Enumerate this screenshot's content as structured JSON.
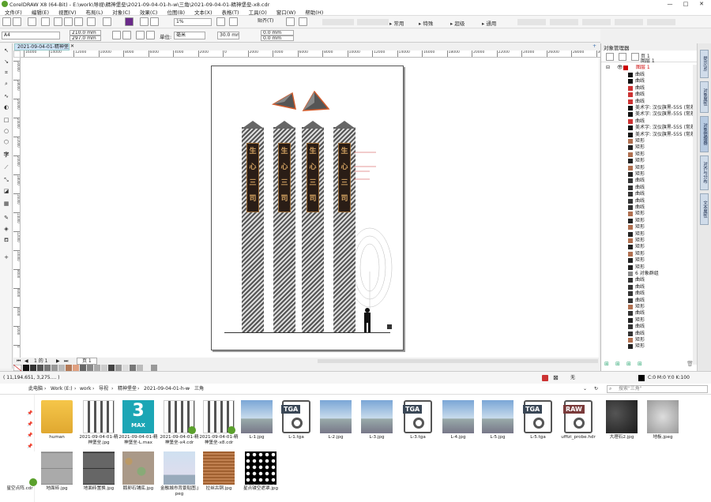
{
  "titlebar": {
    "title": "CorelDRAW X8 (64-Bit) - E:\\work\\导视\\精神堡垒\\2021-09-04-01-h-w\\三角\\2021-09-04-01-精神堡垒-x8.cdr",
    "minimize": "—",
    "maximize": "□",
    "close": "✕"
  },
  "menu": [
    "文件(F)",
    "编辑(E)",
    "视图(V)",
    "布局(L)",
    "对象(C)",
    "效果(C)",
    "位图(B)",
    "文本(X)",
    "表格(T)",
    "工具(O)",
    "窗口(W)",
    "帮助(H)"
  ],
  "toolbar": {
    "zoom": "1%",
    "snap": "贴齐(T)",
    "workspaces": [
      "常用",
      "特殊",
      "超级",
      "通用"
    ],
    "plugin_slots": [
      "slot1",
      "slot2",
      "slot3",
      "slot4",
      "slot5",
      "slot6",
      "slot7",
      "slot8"
    ]
  },
  "propbar": {
    "paper": "A4",
    "width": "210.0 mm",
    "height": "297.0 mm",
    "unit_label": "单位:",
    "unit": "毫米",
    "nudge": "0.1 mm",
    "angle": "30.0 mm",
    "dup_x": "0.0 mm",
    "dup_y": "0.0 mm"
  },
  "document_tab": "2021-09-04-01-精神堡...",
  "ruler_ticks": [
    "16000",
    "14000",
    "12000",
    "10000",
    "8000",
    "6000",
    "4000",
    "2000",
    "0",
    "2000",
    "4000",
    "6000",
    "8000",
    "10000",
    "12000",
    "14000",
    "16000",
    "18000",
    "20000",
    "22000",
    "24000",
    "26000",
    "28000",
    "30000"
  ],
  "vruler_ticks": [
    "30000",
    "28000",
    "26000",
    "24000",
    "22000",
    "20000",
    "18000",
    "16000",
    "14000",
    "12000",
    "10000",
    "8000",
    "6000",
    "4000",
    "2000",
    "0"
  ],
  "pagebar": {
    "counter": "1 的 1",
    "page_tab": "页 1"
  },
  "status": {
    "coords": "( 11,194.651, 3,275.... )",
    "fill_none": "无",
    "color_info": "C:0 M:0 Y:0 K:100"
  },
  "object_manager": {
    "title": "对象管理器",
    "page": "页 1",
    "layer": "图层 1",
    "active_layer": "图层 1",
    "group_label": "6 对象群组",
    "items": [
      {
        "label": "曲线",
        "color": "#111111"
      },
      {
        "label": "曲线",
        "color": "#111111"
      },
      {
        "label": "曲线",
        "color": "#cc3333"
      },
      {
        "label": "曲线",
        "color": "#cc3333"
      },
      {
        "label": "曲线",
        "color": "#cc3333"
      },
      {
        "label": "美术字: 汉仪旗黑-55S (常规)",
        "color": "#111111"
      },
      {
        "label": "美术字: 汉仪旗黑-55S (常规)",
        "color": "#111111"
      },
      {
        "label": "曲线",
        "color": "#cc3333"
      },
      {
        "label": "美术字: 汉仪旗黑-55S (常规)",
        "color": "#111111"
      },
      {
        "label": "美术字: 汉仪旗黑-55S (常规)",
        "color": "#111111"
      },
      {
        "label": "矩形",
        "color": "#b07050"
      },
      {
        "label": "矩形",
        "color": "#222222"
      },
      {
        "label": "矩形",
        "color": "#b07050"
      },
      {
        "label": "矩形",
        "color": "#222222"
      },
      {
        "label": "矩形",
        "color": "#b07050"
      },
      {
        "label": "矩形",
        "color": "#222222"
      },
      {
        "label": "曲线",
        "color": "#333333"
      },
      {
        "label": "曲线",
        "color": "#333333"
      },
      {
        "label": "曲线",
        "color": "#333333"
      },
      {
        "label": "曲线",
        "color": "#333333"
      },
      {
        "label": "曲线",
        "color": "#333333"
      },
      {
        "label": "矩形",
        "color": "#b07050"
      },
      {
        "label": "矩形",
        "color": "#222222"
      },
      {
        "label": "矩形",
        "color": "#b07050"
      },
      {
        "label": "矩形",
        "color": "#222222"
      },
      {
        "label": "矩形",
        "color": "#b07050"
      },
      {
        "label": "矩形",
        "color": "#222222"
      },
      {
        "label": "矩形",
        "color": "#b07050"
      },
      {
        "label": "矩形",
        "color": "#222222"
      },
      {
        "label": "矩形",
        "color": "#222222"
      },
      {
        "label": "6 对象群组",
        "color": "#888888"
      },
      {
        "label": "曲线",
        "color": "#333333"
      },
      {
        "label": "曲线",
        "color": "#333333"
      },
      {
        "label": "曲线",
        "color": "#333333"
      },
      {
        "label": "曲线",
        "color": "#333333"
      },
      {
        "label": "矩形",
        "color": "#b07050"
      },
      {
        "label": "曲线",
        "color": "#333333"
      },
      {
        "label": "矩形",
        "color": "#222222"
      },
      {
        "label": "曲线",
        "color": "#333333"
      },
      {
        "label": "曲线",
        "color": "#333333"
      },
      {
        "label": "矩形",
        "color": "#b07050"
      },
      {
        "label": "矩形",
        "color": "#222222"
      }
    ]
  },
  "right_tabs": [
    "提示(N)",
    "对象属性",
    "对象管理器",
    "对齐与分布",
    "文本属性"
  ],
  "explorer": {
    "breadcrumb": [
      "此电脑",
      "Work (E:)",
      "work",
      "导视",
      "精神堡垒",
      "2021-09-04-01-h-w",
      "三角"
    ],
    "search_placeholder": "搜索\"三角\"",
    "files": [
      {
        "name": "human",
        "kind": "folder"
      },
      {
        "name": "2021-09-04-01-精神堡垒.jpg",
        "kind": "render"
      },
      {
        "name": "2021-09-04-01-精神堡垒-L.max",
        "kind": "max"
      },
      {
        "name": "2021-09-04-01-精神堡垒-x4.cdr",
        "kind": "render"
      },
      {
        "name": "2021-09-04-01-精神堡垒-x8.cdr",
        "kind": "render"
      },
      {
        "name": "L-1.jpg",
        "kind": "photo"
      },
      {
        "name": "L-1.tga",
        "kind": "tga"
      },
      {
        "name": "L-2.jpg",
        "kind": "photo"
      },
      {
        "name": "L-3.jpg",
        "kind": "photo"
      },
      {
        "name": "L-3.tga",
        "kind": "tga"
      },
      {
        "name": "L-4.jpg",
        "kind": "photo"
      },
      {
        "name": "L-5.jpg",
        "kind": "photo"
      },
      {
        "name": "L-5.tga",
        "kind": "tga"
      },
      {
        "name": "uffizi_probe.hdr",
        "kind": "raw"
      },
      {
        "name": "大理石2.jpg",
        "kind": "marble"
      },
      {
        "name": "地板.jpeg",
        "kind": "stone"
      },
      {
        "name": "地面砖.jpg",
        "kind": "tile"
      },
      {
        "name": "地面砖置换.jpg",
        "kind": "tiledark"
      },
      {
        "name": "鹅卵石铺底.jpg",
        "kind": "pebble"
      },
      {
        "name": "金融城市背景贴图.jpeg",
        "kind": "city"
      },
      {
        "name": "拉丝古铜.jpg",
        "kind": "copper"
      },
      {
        "name": "星点镂空遮罩.jpg",
        "kind": "dots"
      },
      {
        "name": "星空点阵.cdr",
        "kind": "cdr"
      }
    ],
    "tga_label": "TGA",
    "raw_label": "RAW",
    "max_label": "3",
    "max_sub": "MAX"
  },
  "plaque_text": [
    "生",
    "心",
    "三",
    "司"
  ]
}
